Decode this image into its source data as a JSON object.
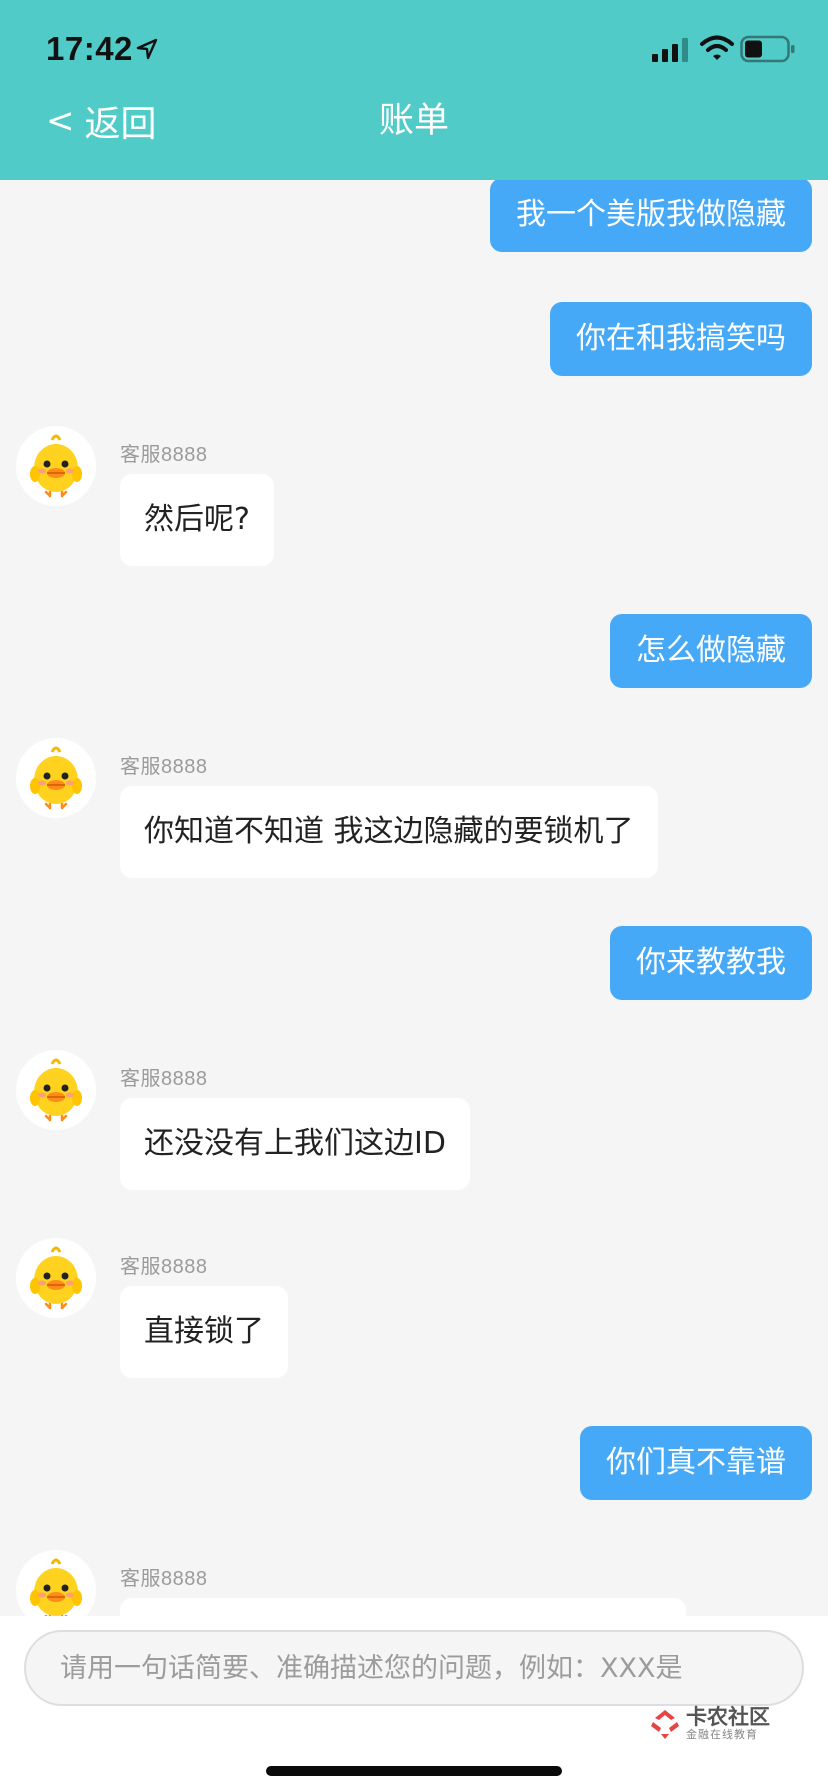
{
  "status_bar": {
    "time": "17:42",
    "icons": [
      "location-arrow-icon",
      "signal-icon",
      "wifi-icon",
      "battery-icon"
    ]
  },
  "nav": {
    "back_label": "返回",
    "back_chevron": "<",
    "title": "账单"
  },
  "colors": {
    "header": "#51cbc8",
    "outgoing_bubble": "#46a9f8",
    "incoming_bubble": "#ffffff",
    "background": "#f5f5f6"
  },
  "messages": [
    {
      "direction": "out",
      "text": "我一个美版我做隐藏"
    },
    {
      "direction": "out",
      "text": "你在和我搞笑吗"
    },
    {
      "direction": "in",
      "sender": "客服8888",
      "text": "然后呢?"
    },
    {
      "direction": "out",
      "text": "怎么做隐藏"
    },
    {
      "direction": "in",
      "sender": "客服8888",
      "text": "你知道不知道 我这边隐藏的要锁机了"
    },
    {
      "direction": "out",
      "text": "你来教教我"
    },
    {
      "direction": "in",
      "sender": "客服8888",
      "text": "还没没有上我们这边ID"
    },
    {
      "direction": "in",
      "sender": "客服8888",
      "text": "直接锁了"
    },
    {
      "direction": "out",
      "text": "你们真不靠谱"
    },
    {
      "direction": "in",
      "sender": "客服8888",
      "text": ""
    }
  ],
  "input": {
    "placeholder": "请用一句话简要、准确描述您的问题，例如：XXX是",
    "value": ""
  },
  "watermark": {
    "title": "卡农社区",
    "subtitle": "金融在线教育"
  }
}
